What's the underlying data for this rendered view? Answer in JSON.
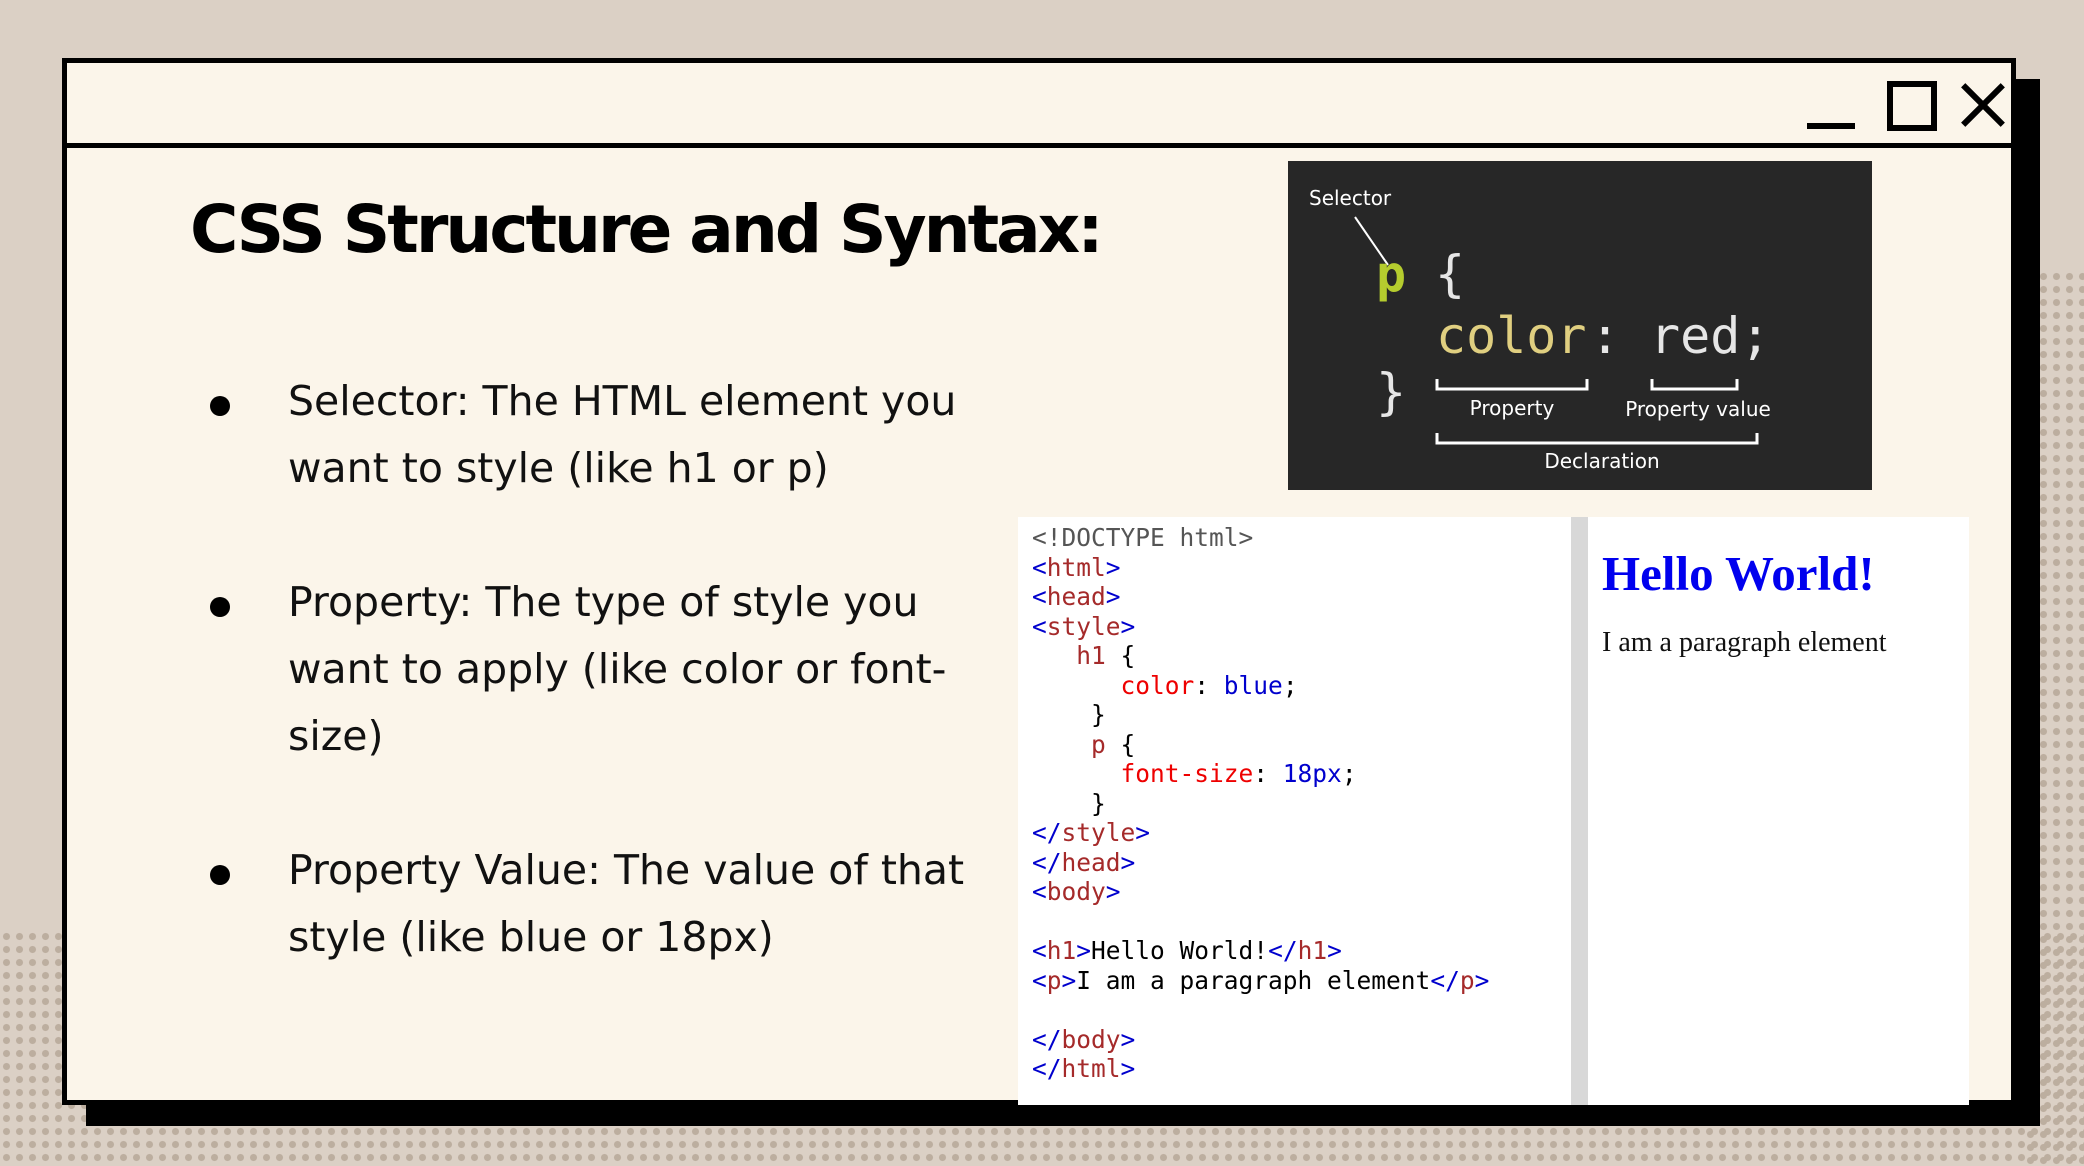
{
  "window": {
    "buttons": {
      "minimize": "minimize",
      "maximize": "maximize",
      "close": "close"
    }
  },
  "slide": {
    "title": "CSS Structure and Syntax:",
    "bullets": [
      "Selector: The HTML element you want to style (like h1 or p)",
      "Property: The type of style you want to apply (like color or font-size)",
      "Property Value: The value of that style (like blue or 18px)"
    ]
  },
  "diagram": {
    "selector_label": "Selector",
    "selector": "p",
    "open_brace": "{",
    "property": "color",
    "colon": ":",
    "value": "red;",
    "close_brace": "}",
    "property_label": "Property",
    "value_label": "Property value",
    "declaration_label": "Declaration"
  },
  "code_example": {
    "lines": [
      [
        {
          "t": "<!DOCTYPE html>",
          "c": "gray"
        }
      ],
      [
        {
          "t": "<",
          "c": "blue"
        },
        {
          "t": "html",
          "c": "tag"
        },
        {
          "t": ">",
          "c": "blue"
        }
      ],
      [
        {
          "t": "<",
          "c": "blue"
        },
        {
          "t": "head",
          "c": "tag"
        },
        {
          "t": ">",
          "c": "blue"
        }
      ],
      [
        {
          "t": "<",
          "c": "blue"
        },
        {
          "t": "style",
          "c": "tag"
        },
        {
          "t": ">",
          "c": "blue"
        }
      ],
      [
        {
          "t": "   ",
          "c": "black"
        },
        {
          "t": "h1",
          "c": "tag"
        },
        {
          "t": " {",
          "c": "black"
        }
      ],
      [
        {
          "t": "      ",
          "c": "black"
        },
        {
          "t": "color",
          "c": "red"
        },
        {
          "t": ": ",
          "c": "black"
        },
        {
          "t": "blue",
          "c": "blue"
        },
        {
          "t": ";",
          "c": "black"
        }
      ],
      [
        {
          "t": "    }",
          "c": "black"
        }
      ],
      [
        {
          "t": "    ",
          "c": "black"
        },
        {
          "t": "p",
          "c": "tag"
        },
        {
          "t": " {",
          "c": "black"
        }
      ],
      [
        {
          "t": "      ",
          "c": "black"
        },
        {
          "t": "font-size",
          "c": "red"
        },
        {
          "t": ": ",
          "c": "black"
        },
        {
          "t": "18px",
          "c": "blue"
        },
        {
          "t": ";",
          "c": "black"
        }
      ],
      [
        {
          "t": "    }",
          "c": "black"
        }
      ],
      [
        {
          "t": "</",
          "c": "blue"
        },
        {
          "t": "style",
          "c": "tag"
        },
        {
          "t": ">",
          "c": "blue"
        }
      ],
      [
        {
          "t": "</",
          "c": "blue"
        },
        {
          "t": "head",
          "c": "tag"
        },
        {
          "t": ">",
          "c": "blue"
        }
      ],
      [
        {
          "t": "<",
          "c": "blue"
        },
        {
          "t": "body",
          "c": "tag"
        },
        {
          "t": ">",
          "c": "blue"
        }
      ],
      [],
      [
        {
          "t": "<",
          "c": "blue"
        },
        {
          "t": "h1",
          "c": "tag"
        },
        {
          "t": ">",
          "c": "blue"
        },
        {
          "t": "Hello World!",
          "c": "black"
        },
        {
          "t": "</",
          "c": "blue"
        },
        {
          "t": "h1",
          "c": "tag"
        },
        {
          "t": ">",
          "c": "blue"
        }
      ],
      [
        {
          "t": "<",
          "c": "blue"
        },
        {
          "t": "p",
          "c": "tag"
        },
        {
          "t": ">",
          "c": "blue"
        },
        {
          "t": "I am a paragraph element",
          "c": "black"
        },
        {
          "t": "</",
          "c": "blue"
        },
        {
          "t": "p",
          "c": "tag"
        },
        {
          "t": ">",
          "c": "blue"
        }
      ],
      [],
      [
        {
          "t": "</",
          "c": "blue"
        },
        {
          "t": "body",
          "c": "tag"
        },
        {
          "t": ">",
          "c": "blue"
        }
      ],
      [
        {
          "t": "</",
          "c": "blue"
        },
        {
          "t": "html",
          "c": "tag"
        },
        {
          "t": ">",
          "c": "blue"
        }
      ]
    ]
  },
  "preview": {
    "heading": "Hello World!",
    "paragraph": "I am a paragraph element"
  },
  "colors": {
    "page_background": "#dbd0c5",
    "window_background": "#fbf5ea",
    "diagram_background": "#272727",
    "selector_green": "#b5cc2e",
    "property_yellow": "#e0cf80",
    "preview_blue": "#0000ee"
  }
}
